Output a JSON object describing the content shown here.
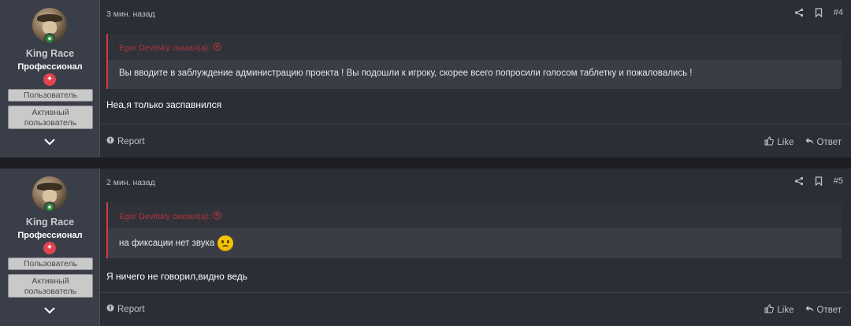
{
  "posts": [
    {
      "username": "King Race",
      "user_title": "Профессионал",
      "banners": [
        "Пользователь",
        "Активный пользователь"
      ],
      "time": "3 мин. назад",
      "post_number": "#4",
      "quote_author": "Egor Devitsky сказал(а):",
      "quote_text": "Вы вводите в заблуждение администрацию проекта ! Вы подошли к игроку, скорее всего попросили голосом таблетку и пожаловались !",
      "message": "Неа,я только заспавнился",
      "report_label": "Report",
      "like_label": "Like",
      "reply_label": "Ответ"
    },
    {
      "username": "King Race",
      "user_title": "Профессионал",
      "banners": [
        "Пользователь",
        "Активный пользователь"
      ],
      "time": "2 мин. назад",
      "post_number": "#5",
      "quote_author": "Egor Devitsky сказал(а):",
      "quote_text": "на фиксации нет звука",
      "message": "Я ничего не говорил,видно ведь",
      "report_label": "Report",
      "like_label": "Like",
      "reply_label": "Ответ"
    }
  ],
  "icons": {
    "share": "share-icon",
    "bookmark": "bookmark-icon",
    "report": "report-icon",
    "like": "like-icon",
    "reply": "reply-icon",
    "expand": "chevron-down-icon",
    "quote_jump": "arrow-up-circle-icon",
    "emoji": "sad-face-icon"
  },
  "colors": {
    "accent": "#d23b45",
    "online": "#2e8b3a",
    "rank_badge": "#e0444e"
  }
}
